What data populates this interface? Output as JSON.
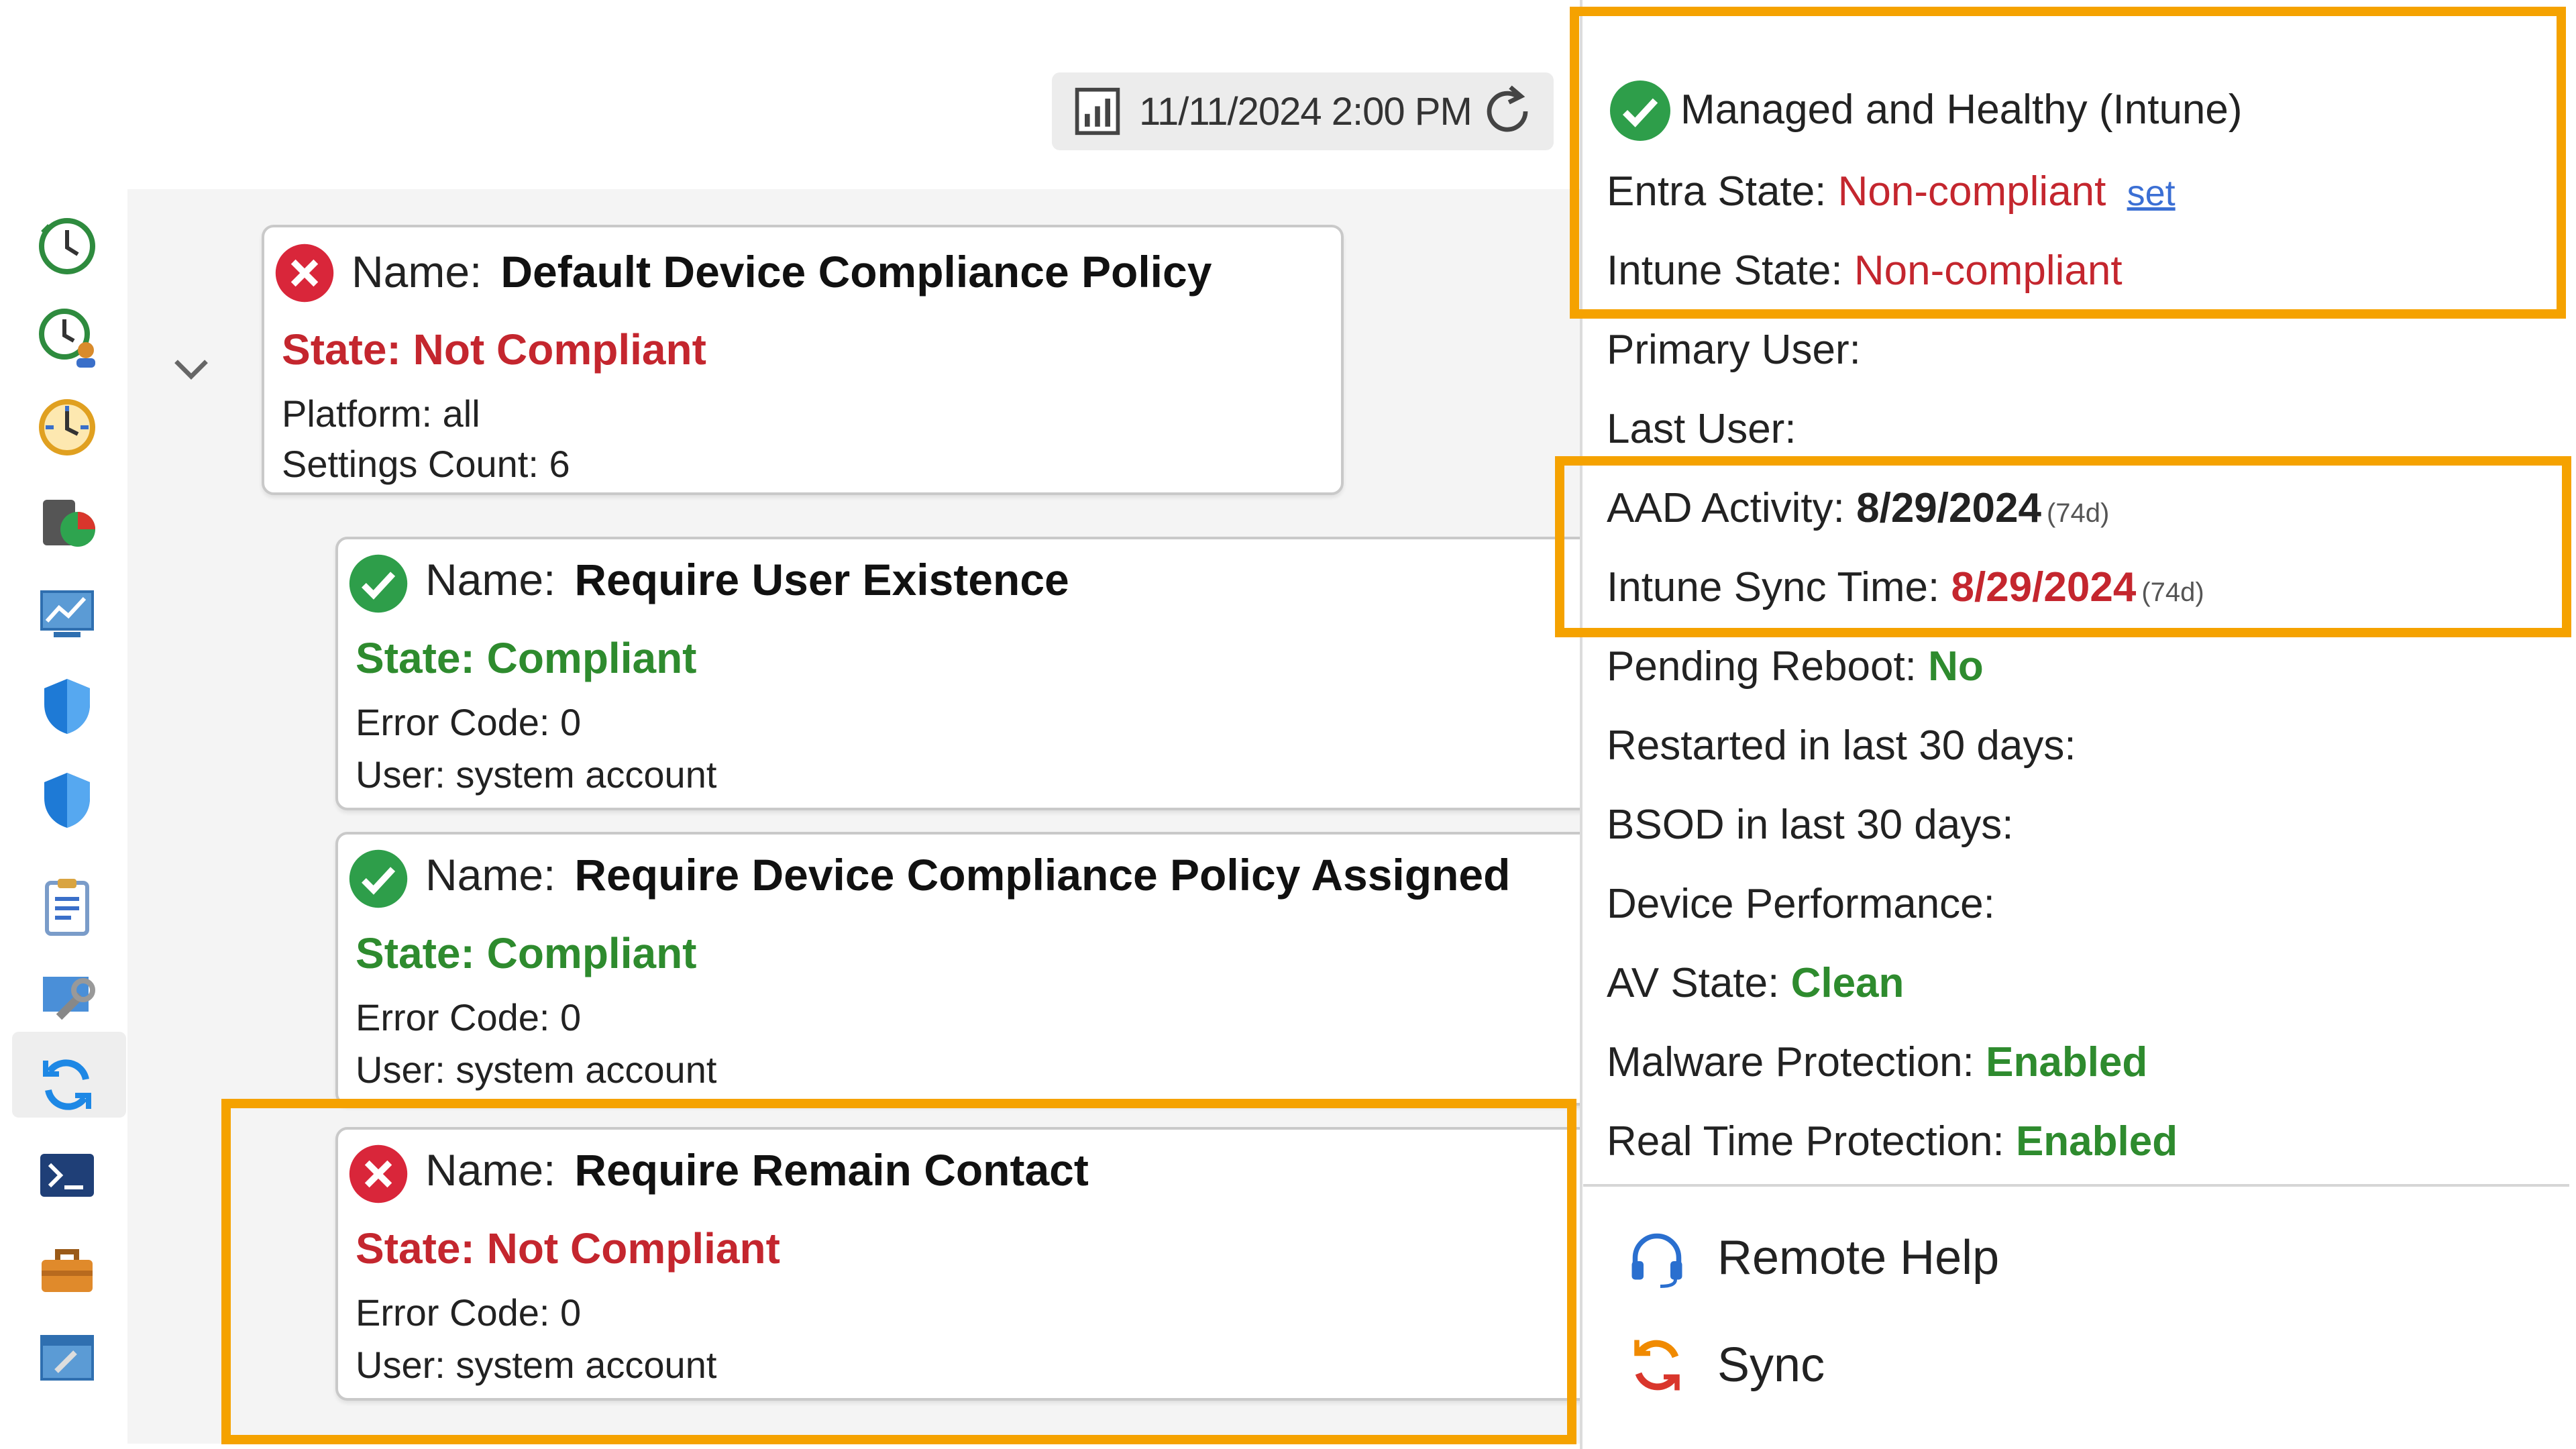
{
  "toolbar": {
    "date_time": "11/11/2024  2:00 PM",
    "icons": [
      "report-icon",
      "refresh-icon"
    ]
  },
  "sidebar": {
    "items": [
      {
        "icon": "clock-check-icon"
      },
      {
        "icon": "clock-user-icon"
      },
      {
        "icon": "schedule-clock-icon"
      },
      {
        "icon": "device-chart-icon"
      },
      {
        "icon": "monitor-graph-icon"
      },
      {
        "icon": "shield-icon"
      },
      {
        "icon": "shield-icon"
      },
      {
        "icon": "compliance-report-icon",
        "selected": true
      },
      {
        "icon": "tools-icon"
      },
      {
        "icon": "sync-icon"
      },
      {
        "icon": "powershell-icon"
      },
      {
        "icon": "toolbox-icon"
      },
      {
        "icon": "window-tools-icon"
      }
    ]
  },
  "policy": {
    "name_label": "Name:",
    "name": "Default Device Compliance Policy",
    "state": "State: Not Compliant",
    "platform": "Platform: all",
    "settings_count": "Settings Count: 6"
  },
  "settings": [
    {
      "name_label": "Name:",
      "name": "Require User Existence",
      "state": "State: Compliant",
      "error_code": "Error Code: 0",
      "user": "User: system account",
      "status": "compliant"
    },
    {
      "name_label": "Name:",
      "name": "Require Device Compliance Policy Assigned",
      "state": "State: Compliant",
      "error_code": "Error Code: 0",
      "user": "User: system account",
      "status": "compliant"
    },
    {
      "name_label": "Name:",
      "name": "Require Remain Contact",
      "state": "State: Not Compliant",
      "error_code": "Error Code: 0",
      "user": "User: system account",
      "status": "not-compliant"
    }
  ],
  "device": {
    "health": "Managed and Healthy (Intune)",
    "entra_label": "Entra State:",
    "entra_value": "Non-compliant",
    "entra_link": "set",
    "intune_label": "Intune State:",
    "intune_value": "Non-compliant",
    "primary_user_label": "Primary User:",
    "last_user_label": "Last User:",
    "aad_label": "AAD Activity:",
    "aad_value": "8/29/2024",
    "aad_age": "(74d)",
    "sync_label": "Intune Sync Time:",
    "sync_value": "8/29/2024",
    "sync_age": "(74d)",
    "reboot_label": "Pending Reboot:",
    "reboot_value": "No",
    "restarted_label": "Restarted in last 30 days:",
    "bsod_label": "BSOD in last 30 days:",
    "performance_label": "Device Performance:",
    "av_label": "AV State:",
    "av_value": "Clean",
    "malware_label": "Malware Protection:",
    "malware_value": "Enabled",
    "rtp_label": "Real Time Protection:",
    "rtp_value": "Enabled"
  },
  "actions": {
    "remote_help": "Remote Help",
    "sync": "Sync"
  },
  "colors": {
    "highlight": "#f5a200",
    "error_red": "#c4262e",
    "success_green": "#2e8b2e",
    "link_blue": "#3b6fd4"
  }
}
